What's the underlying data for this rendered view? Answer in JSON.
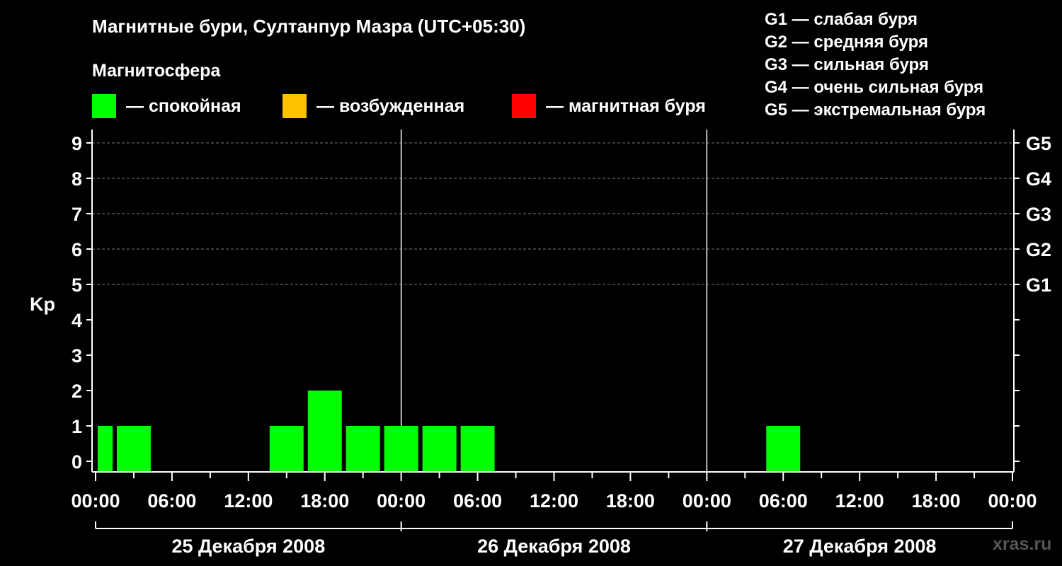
{
  "header": {
    "title": "Магнитные бури, Султанпур Мазра (UTC+05:30)",
    "subtitle": "Магнитосфера"
  },
  "legend": [
    {
      "label": "— спокойная",
      "color": "#00ff00"
    },
    {
      "label": "— возбужденная",
      "color": "#ffc000"
    },
    {
      "label": "— магнитная буря",
      "color": "#ff0000"
    }
  ],
  "storm_scale": [
    "G1 — слабая буря",
    "G2 — средняя буря",
    "G3 — сильная буря",
    "G4 — очень сильная буря",
    "G5 — экстремальная буря"
  ],
  "watermark": "xras.ru",
  "chart_data": {
    "type": "bar",
    "ylabel": "Kp",
    "ylim": [
      0,
      9
    ],
    "y_ticks": [
      "0",
      "1",
      "2",
      "3",
      "4",
      "5",
      "6",
      "7",
      "8",
      "9"
    ],
    "g_levels": [
      {
        "kp": 5,
        "label": "G1"
      },
      {
        "kp": 6,
        "label": "G2"
      },
      {
        "kp": 7,
        "label": "G3"
      },
      {
        "kp": 8,
        "label": "G4"
      },
      {
        "kp": 9,
        "label": "G5"
      }
    ],
    "x_ticks": [
      "00:00",
      "06:00",
      "12:00",
      "18:00",
      "00:00",
      "06:00",
      "12:00",
      "18:00",
      "00:00",
      "06:00",
      "12:00",
      "18:00",
      "00:00"
    ],
    "days": [
      "25 Декабря 2008",
      "26 Декабря 2008",
      "27 Декабря 2008"
    ],
    "grid": true,
    "bar_color": "#00ff00",
    "values": [
      {
        "day": "25 Декабря 2008",
        "start_hour": 0,
        "end_hour": 1.5,
        "kp": 1
      },
      {
        "day": "25 Декабря 2008",
        "start_hour": 1.5,
        "end_hour": 4.5,
        "kp": 1
      },
      {
        "day": "25 Декабря 2008",
        "start_hour": 4.5,
        "end_hour": 7.5,
        "kp": 0
      },
      {
        "day": "25 Декабря 2008",
        "start_hour": 7.5,
        "end_hour": 10.5,
        "kp": 0
      },
      {
        "day": "25 Декабря 2008",
        "start_hour": 10.5,
        "end_hour": 13.5,
        "kp": 0
      },
      {
        "day": "25 Декабря 2008",
        "start_hour": 13.5,
        "end_hour": 16.5,
        "kp": 1
      },
      {
        "day": "25 Декабря 2008",
        "start_hour": 16.5,
        "end_hour": 19.5,
        "kp": 2
      },
      {
        "day": "25 Декабря 2008",
        "start_hour": 19.5,
        "end_hour": 22.5,
        "kp": 1
      },
      {
        "day": "25 Декабря 2008",
        "start_hour": 22.5,
        "end_hour": 25.5,
        "kp": 1
      },
      {
        "day": "26 Декабря 2008",
        "start_hour": 1.5,
        "end_hour": 4.5,
        "kp": 1
      },
      {
        "day": "26 Декабря 2008",
        "start_hour": 4.5,
        "end_hour": 7.5,
        "kp": 1
      },
      {
        "day": "26 Декабря 2008",
        "start_hour": 7.5,
        "end_hour": 10.5,
        "kp": 0
      },
      {
        "day": "26 Декабря 2008",
        "start_hour": 10.5,
        "end_hour": 13.5,
        "kp": 0
      },
      {
        "day": "26 Декабря 2008",
        "start_hour": 13.5,
        "end_hour": 16.5,
        "kp": 0
      },
      {
        "day": "26 Декабря 2008",
        "start_hour": 16.5,
        "end_hour": 19.5,
        "kp": 0
      },
      {
        "day": "26 Декабря 2008",
        "start_hour": 19.5,
        "end_hour": 22.5,
        "kp": 0
      },
      {
        "day": "26 Декабря 2008",
        "start_hour": 22.5,
        "end_hour": 25.5,
        "kp": 0
      },
      {
        "day": "27 Декабря 2008",
        "start_hour": 1.5,
        "end_hour": 4.5,
        "kp": 0
      },
      {
        "day": "27 Декабря 2008",
        "start_hour": 4.5,
        "end_hour": 7.5,
        "kp": 1
      },
      {
        "day": "27 Декабря 2008",
        "start_hour": 7.5,
        "end_hour": 10.5,
        "kp": 0
      },
      {
        "day": "27 Декабря 2008",
        "start_hour": 10.5,
        "end_hour": 13.5,
        "kp": 0
      },
      {
        "day": "27 Декабря 2008",
        "start_hour": 13.5,
        "end_hour": 16.5,
        "kp": 0
      },
      {
        "day": "27 Декабря 2008",
        "start_hour": 16.5,
        "end_hour": 19.5,
        "kp": 0
      },
      {
        "day": "27 Декабря 2008",
        "start_hour": 19.5,
        "end_hour": 22.5,
        "kp": 0
      },
      {
        "day": "27 Декабря 2008",
        "start_hour": 22.5,
        "end_hour": 24,
        "kp": 0
      }
    ]
  }
}
